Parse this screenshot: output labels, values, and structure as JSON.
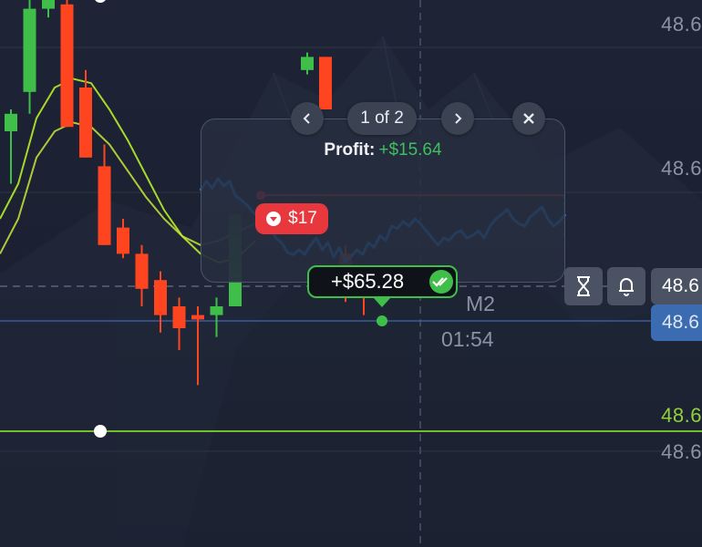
{
  "price_axis": {
    "labels": [
      "48.6",
      "48.6",
      "48.6",
      "48.6"
    ],
    "green_line_label": "48.6"
  },
  "trade_popup": {
    "pager_text": "1 of 2",
    "profit_label": "Profit:",
    "profit_value": "+$15.64",
    "loss_badge": "$17",
    "colors": {
      "up": "#3fbf49",
      "down": "#ff4520",
      "line": "#1f8fff",
      "loss": "#e8383d"
    }
  },
  "result_badge": {
    "amount": "+$65.28"
  },
  "timeframe": {
    "label": "M2",
    "countdown": "01:54"
  },
  "toolbar": {
    "icons": [
      "hourglass-icon",
      "bell-icon"
    ]
  },
  "price_tags": {
    "current": "48.6",
    "secondary": "48.6"
  },
  "chart_data": {
    "type": "candlestick",
    "candles": [
      {
        "o": 0.7,
        "h": 0.75,
        "l": 0.58,
        "c": 0.74
      },
      {
        "o": 0.79,
        "h": 1.0,
        "l": 0.74,
        "c": 0.98
      },
      {
        "o": 0.98,
        "h": 1.0,
        "l": 0.96,
        "c": 1.0
      },
      {
        "o": 0.99,
        "h": 1.0,
        "l": 0.71,
        "c": 0.71
      },
      {
        "o": 0.8,
        "h": 0.84,
        "l": 0.64,
        "c": 0.64
      },
      {
        "o": 0.62,
        "h": 0.67,
        "l": 0.44,
        "c": 0.44
      },
      {
        "o": 0.48,
        "h": 0.5,
        "l": 0.41,
        "c": 0.42
      },
      {
        "o": 0.42,
        "h": 0.44,
        "l": 0.3,
        "c": 0.34
      },
      {
        "o": 0.36,
        "h": 0.38,
        "l": 0.24,
        "c": 0.28
      },
      {
        "o": 0.3,
        "h": 0.32,
        "l": 0.2,
        "c": 0.25
      },
      {
        "o": 0.28,
        "h": 0.3,
        "l": 0.12,
        "c": 0.27
      },
      {
        "o": 0.28,
        "h": 0.32,
        "l": 0.23,
        "c": 0.3
      },
      {
        "o": 0.3,
        "h": 0.51,
        "l": 0.3,
        "c": 0.51
      }
    ],
    "right_candles": [
      {
        "o": 0.84,
        "h": 0.88,
        "l": 0.83,
        "c": 0.87
      },
      {
        "o": 0.87,
        "h": 0.87,
        "l": 0.75,
        "c": 0.75
      },
      {
        "o": 0.42,
        "h": 0.44,
        "l": 0.31,
        "c": 0.38
      },
      {
        "o": 0.38,
        "h": 0.39,
        "l": 0.28,
        "c": 0.37
      }
    ],
    "ma_fast": [
      0.5,
      0.58,
      0.73,
      0.8,
      0.82,
      0.81,
      0.75,
      0.68,
      0.6,
      0.52,
      0.46,
      0.42,
      0.4,
      0.41,
      0.45
    ],
    "ma_slow": [
      0.42,
      0.5,
      0.64,
      0.7,
      0.72,
      0.71,
      0.67,
      0.61,
      0.55,
      0.5,
      0.46,
      0.44,
      0.45,
      0.47,
      0.49
    ],
    "popup_series": [
      0.7,
      0.78,
      0.72,
      0.8,
      0.74,
      0.78,
      0.66,
      0.62,
      0.58,
      0.52,
      0.48,
      0.44,
      0.4,
      0.3,
      0.26,
      0.18,
      0.16,
      0.2,
      0.16,
      0.24,
      0.3,
      0.2,
      0.26,
      0.14,
      0.22,
      0.1,
      0.14,
      0.2,
      0.16,
      0.26,
      0.22,
      0.32,
      0.28,
      0.4,
      0.38,
      0.44,
      0.4,
      0.46,
      0.42,
      0.36,
      0.3,
      0.24,
      0.3,
      0.28,
      0.34,
      0.36,
      0.3,
      0.32,
      0.36,
      0.3,
      0.4,
      0.46,
      0.5,
      0.54,
      0.46,
      0.42,
      0.4,
      0.48,
      0.52,
      0.56,
      0.46,
      0.4,
      0.44,
      0.5
    ],
    "strike_level": 0.66
  }
}
